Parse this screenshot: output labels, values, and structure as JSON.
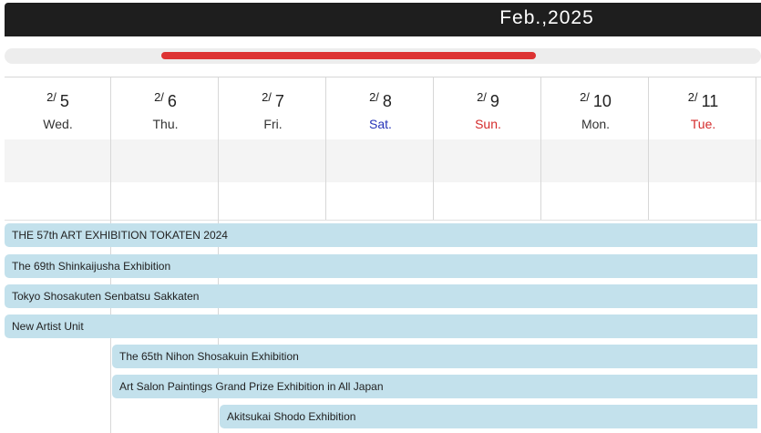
{
  "header": {
    "month_title": "Feb.,2025"
  },
  "days": [
    {
      "month": "2/",
      "day": "5",
      "dow": "Wed."
    },
    {
      "month": "2/",
      "day": "6",
      "dow": "Thu."
    },
    {
      "month": "2/",
      "day": "7",
      "dow": "Fri."
    },
    {
      "month": "2/",
      "day": "8",
      "dow": "Sat."
    },
    {
      "month": "2/",
      "day": "9",
      "dow": "Sun."
    },
    {
      "month": "2/",
      "day": "10",
      "dow": "Mon."
    },
    {
      "month": "2/",
      "day": "11",
      "dow": "Tue."
    }
  ],
  "colors": {
    "saturday": "#2633b8",
    "sunday_holiday": "#d42b2b",
    "event_bar": "#c3e1ec",
    "scroll_thumb": "#dd3333"
  },
  "events": [
    {
      "title": "THE 57th ART EXHIBITION TOKATEN 2024"
    },
    {
      "title": "The 69th Shinkaijusha Exhibition"
    },
    {
      "title": "Tokyo Shosakuten Senbatsu Sakkaten"
    },
    {
      "title": "New Artist Unit"
    },
    {
      "title": "The 65th Nihon Shosakuin Exhibition"
    },
    {
      "title": "Art Salon Paintings Grand Prize Exhibition in All Japan"
    },
    {
      "title": "Akitsukai Shodo Exhibition"
    }
  ]
}
